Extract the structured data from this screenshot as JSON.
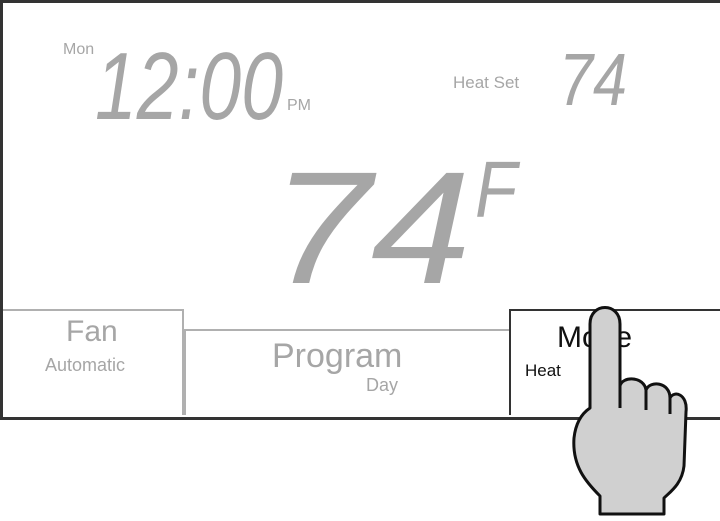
{
  "display": {
    "day": "Mon",
    "time": "12:00",
    "ampm": "PM",
    "heat_set_label": "Heat Set",
    "heat_set_value": "74",
    "current_temp": "74",
    "temp_unit": "F"
  },
  "buttons": {
    "fan": {
      "title": "Fan",
      "subtitle": "Automatic"
    },
    "program": {
      "title": "Program",
      "subtitle": "Day"
    },
    "mode": {
      "title": "Mode",
      "subtitle": "Heat"
    }
  },
  "colors": {
    "segment_gray": "#a6a6a6",
    "frame": "#333333",
    "hand_fill": "#d0d0d0"
  },
  "icons": {
    "pointer": "hand-pointer-icon"
  }
}
